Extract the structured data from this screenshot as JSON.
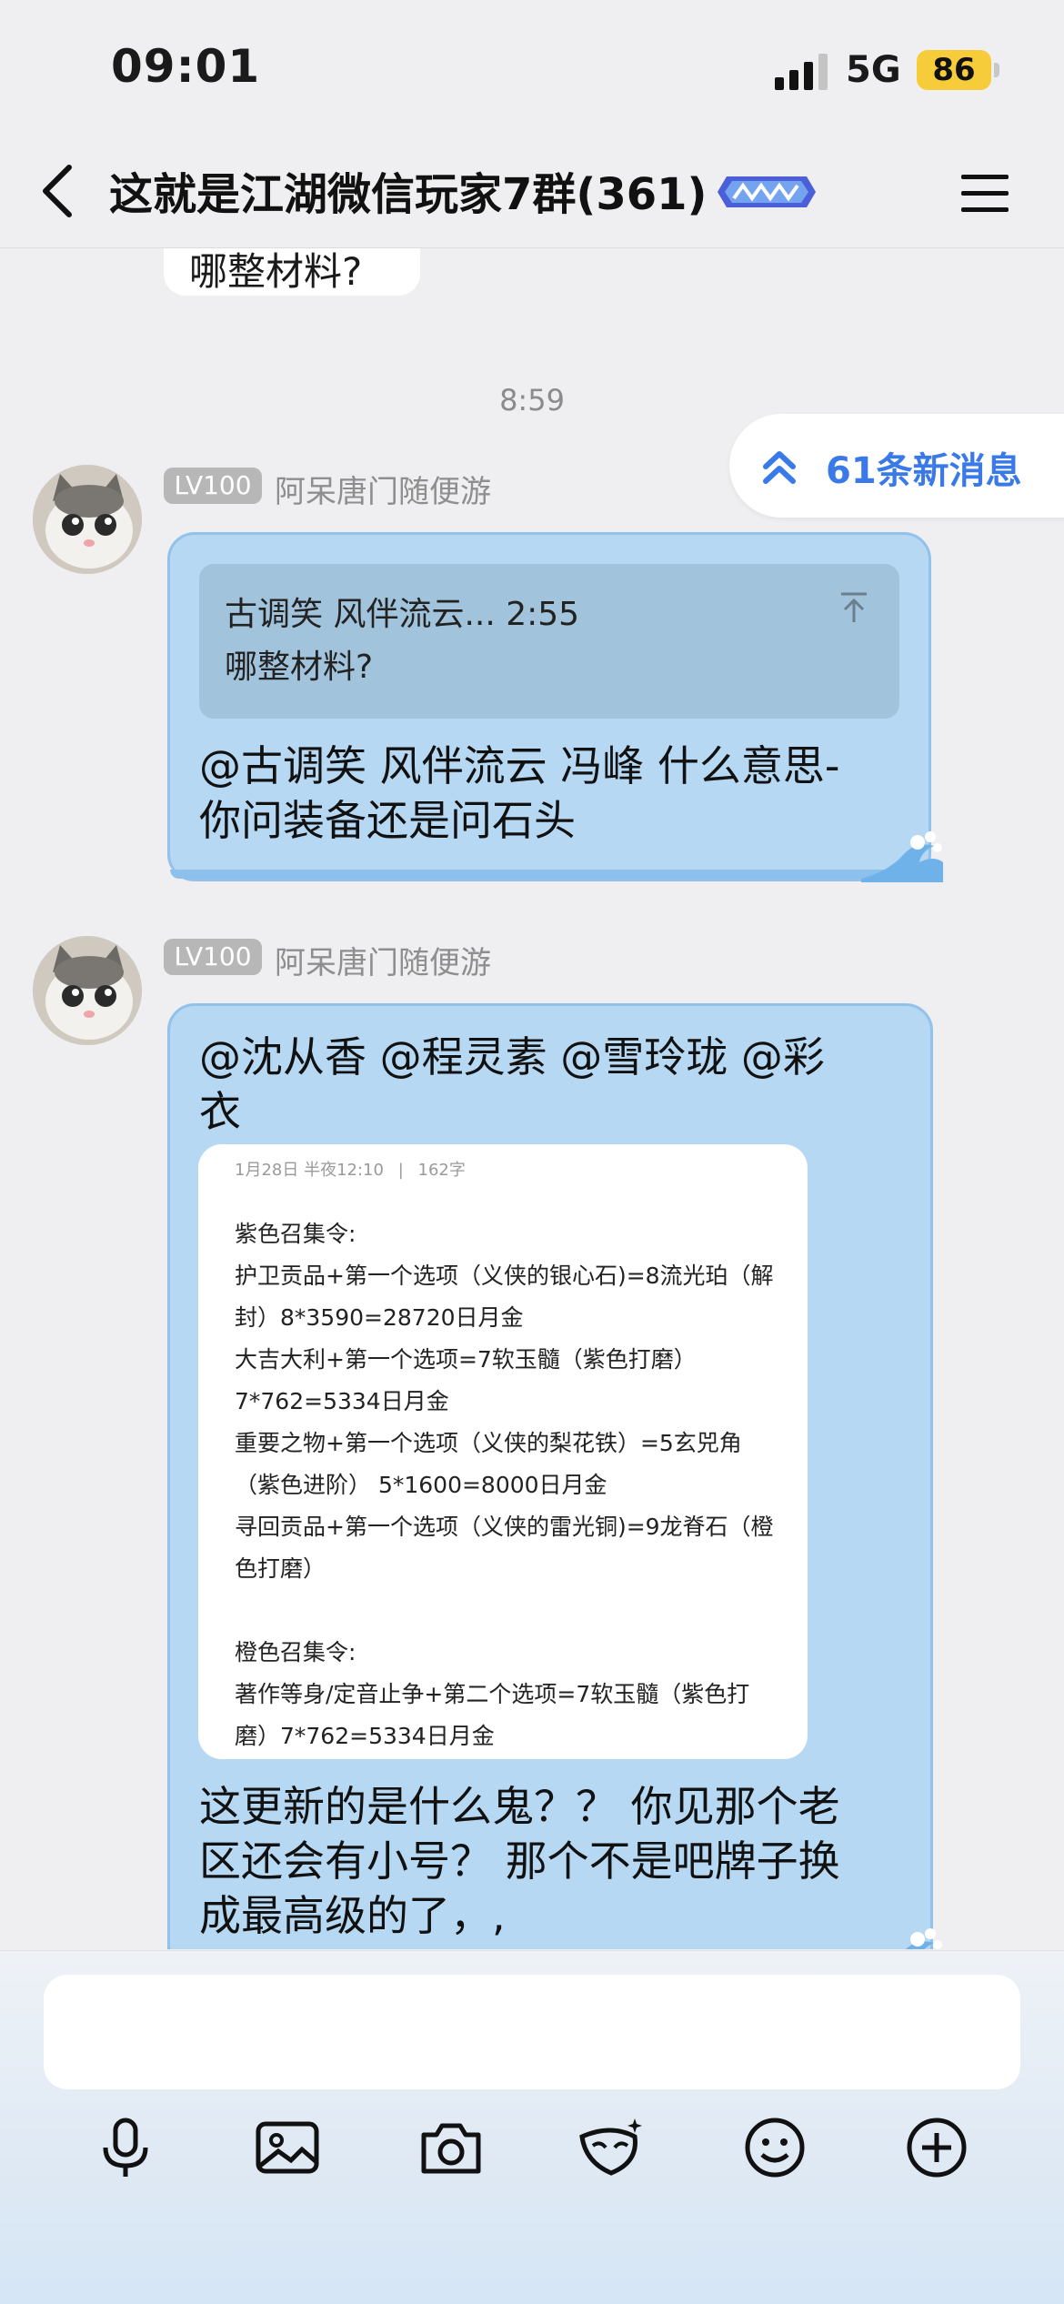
{
  "status_bar": {
    "time": "09:01",
    "network": "5G",
    "battery": "86"
  },
  "header": {
    "title": "这就是江湖微信玩家7群(361)",
    "badge_icon": "game-logo-badge"
  },
  "previous_message": {
    "text": "哪整材料?"
  },
  "time_divider": "8:59",
  "new_messages": {
    "label": "61条新消息"
  },
  "messages": [
    {
      "level": "LV100",
      "sender": "阿呆唐门随便游",
      "quote": {
        "header": "古调笑 风伴流云... 2:55",
        "text": "哪整材料?"
      },
      "text_lines": [
        "@古调笑 风伴流云 冯峰 什么意思-",
        "你问装备还是问石头"
      ]
    },
    {
      "level": "LV100",
      "sender": "阿呆唐门随便游",
      "mention_lines": [
        "@沈从香 @程灵素 @雪玲珑 @彩",
        "衣"
      ],
      "card": {
        "date": "1月28日 半夜12:10",
        "sep": "|",
        "count": "162字",
        "lines": [
          "紫色召集令:",
          "护卫贡品+第一个选项（义侠的银心石)=8流光珀（解",
          "封）8*3590=28720日月金",
          "大吉大利+第一个选项=7软玉髓（紫色打磨）",
          "7*762=5334日月金",
          "重要之物+第一个选项（义侠的梨花铁）=5玄兕角",
          "（紫色进阶） 5*1600=8000日月金",
          "寻回贡品+第一个选项（义侠的雷光铜)=9龙脊石（橙",
          "色打磨）",
          "",
          "橙色召集令:",
          "著作等身/定音止争+第二个选项=7软玉髓（紫色打",
          "磨）7*762=5334日月金"
        ]
      },
      "text_lines": [
        "这更新的是什么鬼？？ 你见那个老",
        "区还会有小号？ 那个不是吧牌子换",
        "成最高级的了，,"
      ]
    }
  ],
  "composer": {
    "placeholder": "",
    "tools": [
      "microphone-icon",
      "image-icon",
      "camera-icon",
      "mask-icon",
      "emoji-icon",
      "plus-icon"
    ]
  },
  "colors": {
    "bubble": "#b6d8f3",
    "accent": "#3a7ae8",
    "battery": "#f7cc3a"
  }
}
